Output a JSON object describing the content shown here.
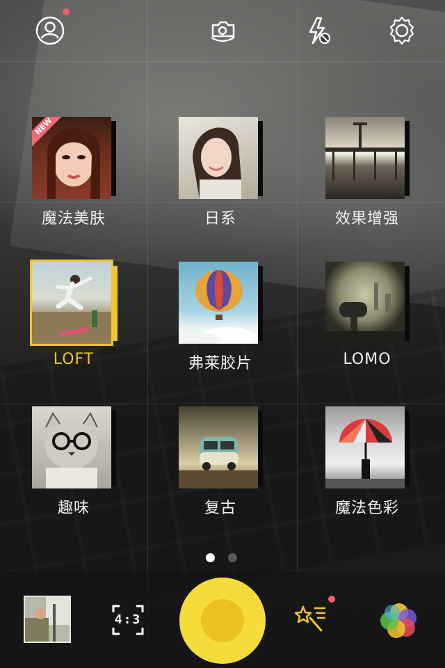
{
  "top_bar": {
    "profile_icon": "profile-icon",
    "switch_camera_icon": "switch-camera-icon",
    "flash_icon": "flash-off-icon",
    "settings_icon": "settings-icon",
    "notification_color": "#f2606a"
  },
  "filters": [
    {
      "label": "魔法美肤",
      "badge": "NEW",
      "selected": false
    },
    {
      "label": "日系",
      "selected": false
    },
    {
      "label": "效果增强",
      "selected": false
    },
    {
      "label": "LOFT",
      "selected": true
    },
    {
      "label": "弗莱胶片",
      "selected": false
    },
    {
      "label": "LOMO",
      "selected": false
    },
    {
      "label": "趣味",
      "selected": false
    },
    {
      "label": "复古",
      "selected": false
    },
    {
      "label": "魔法色彩",
      "selected": false
    }
  ],
  "pager": {
    "pages": 2,
    "current": 1
  },
  "bottom_bar": {
    "gallery_icon": "gallery-thumbnail",
    "aspect_ratio": "4:3",
    "shutter_icon": "shutter-button",
    "magic_icon": "magic-wand-icon",
    "color_icon": "color-circles-icon"
  },
  "colors": {
    "accent": "#f0c62c",
    "shutter": "#f6dc3a",
    "badge": "#f06a74"
  }
}
